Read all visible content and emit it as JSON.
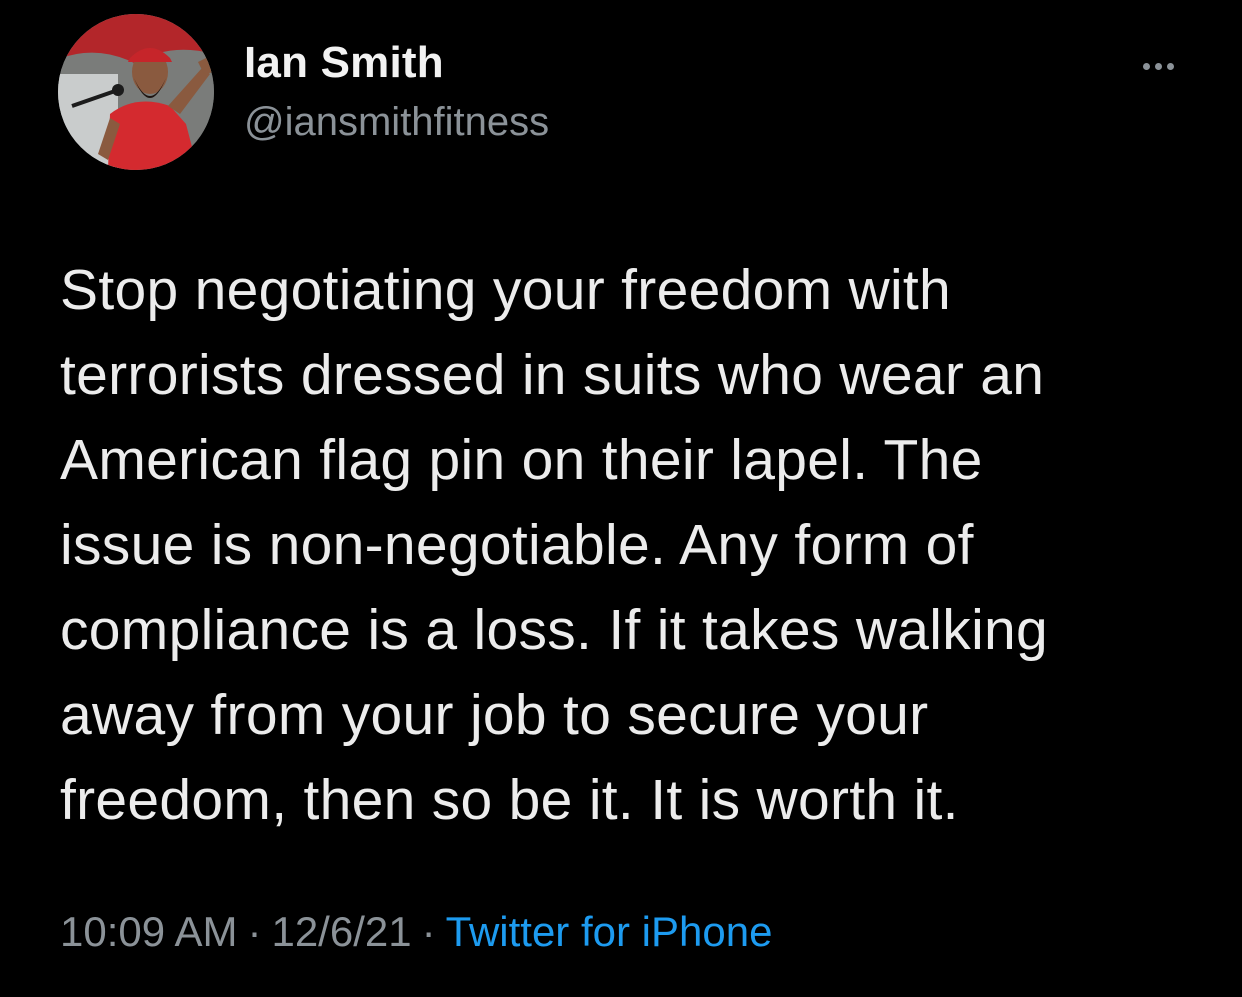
{
  "user": {
    "name": "Ian Smith",
    "handle": "@iansmithfitness",
    "avatar_icon": "profile-photo"
  },
  "tweet": {
    "text_lines": [
      "Stop negotiating your freedom with",
      "terrorists dressed in suits who wear an",
      "American flag pin on their lapel. The",
      "issue is non-negotiable. Any form of",
      "compliance is a loss. If it takes walking",
      "away from your job to secure your",
      "freedom, then so be it. It is worth it."
    ]
  },
  "meta": {
    "time": "10:09 AM",
    "separator": "·",
    "date": "12/6/21",
    "source": "Twitter for iPhone"
  },
  "colors": {
    "background": "#000000",
    "text": "#ececec",
    "secondary": "#8b9298",
    "link": "#1d9bf0"
  },
  "icons": {
    "more": "more-options-icon"
  }
}
